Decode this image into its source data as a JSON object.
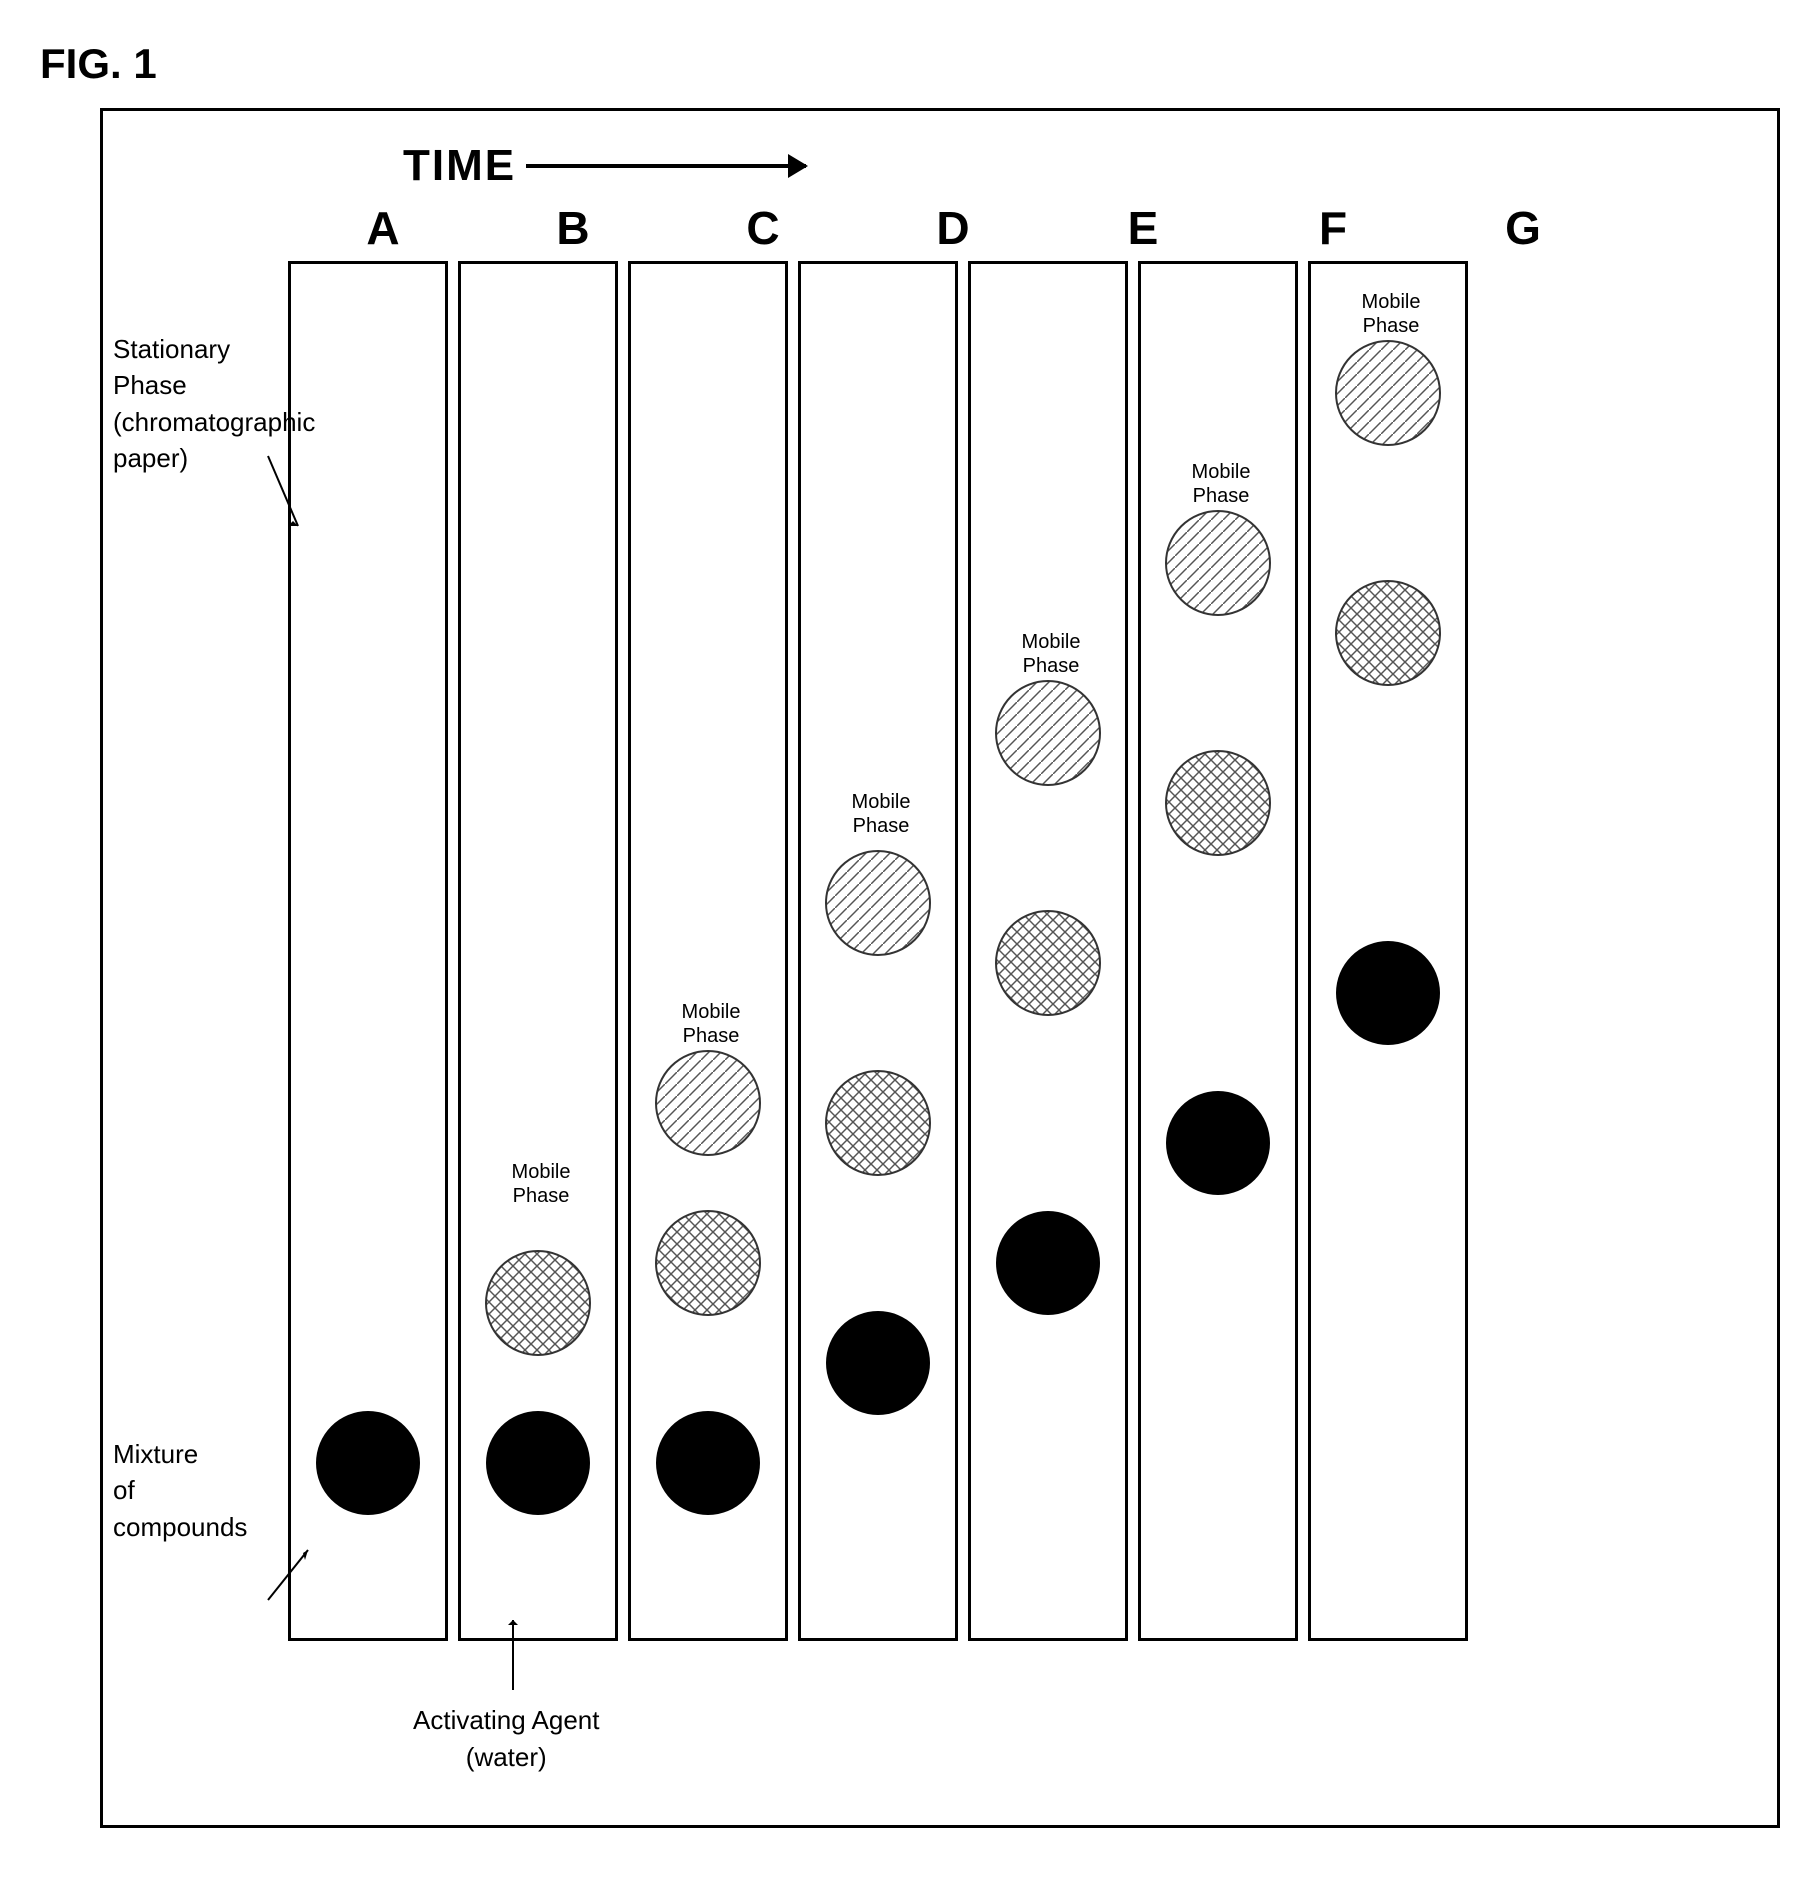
{
  "fig_title": "FIG. 1",
  "time_label": "TIME",
  "columns": [
    "A",
    "B",
    "C",
    "D",
    "E",
    "F",
    "G"
  ],
  "stationary_phase_label": "Stationary Phase\n(chromatographic\npaper)",
  "mixture_label": "Mixture\nof compounds",
  "activating_agent_label": "Activating Agent\n(water)",
  "mobile_phase_label": "Mobile\nPhase",
  "colors": {
    "black": "#000000",
    "white": "#ffffff",
    "border": "#000000"
  }
}
